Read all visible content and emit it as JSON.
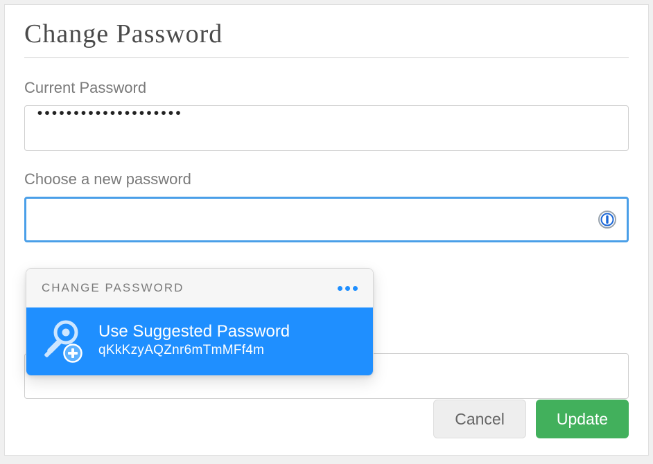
{
  "title": "Change Password",
  "fields": {
    "current": {
      "label": "Current Password",
      "masked_value": "••••••••••••••••••••"
    },
    "new": {
      "label": "Choose a new password",
      "value": ""
    }
  },
  "password_manager": {
    "header": "CHANGE PASSWORD",
    "suggest_title": "Use Suggested Password",
    "suggest_value": "qKkKzyAQZnr6mTmMFf4m"
  },
  "buttons": {
    "cancel": "Cancel",
    "update": "Update"
  }
}
